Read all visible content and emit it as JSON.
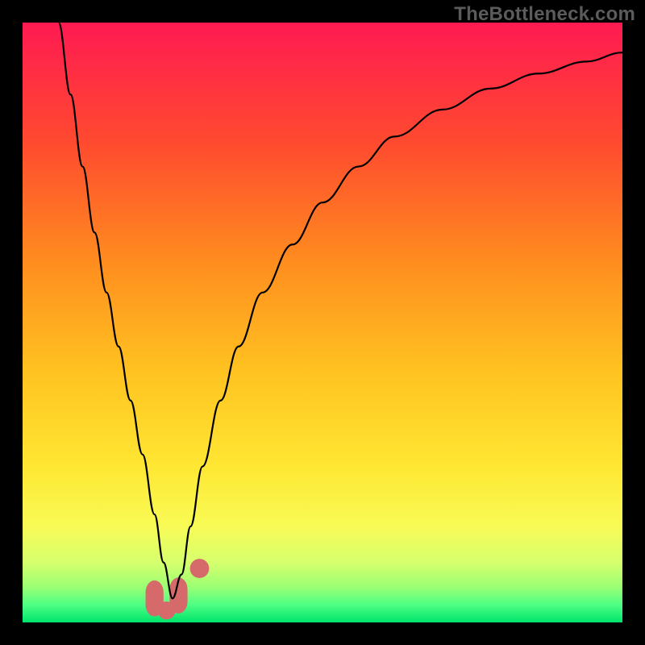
{
  "watermark": "TheBottleneck.com",
  "chart_data": {
    "type": "line",
    "title": "",
    "xlabel": "",
    "ylabel": "",
    "xlim": [
      0,
      100
    ],
    "ylim": [
      0,
      100
    ],
    "grid": false,
    "legend": false,
    "background_gradient": {
      "stops": [
        {
          "offset": 0.0,
          "color": "#ff1a52"
        },
        {
          "offset": 0.2,
          "color": "#ff4a2f"
        },
        {
          "offset": 0.4,
          "color": "#ff8d1f"
        },
        {
          "offset": 0.58,
          "color": "#ffc220"
        },
        {
          "offset": 0.74,
          "color": "#ffe733"
        },
        {
          "offset": 0.84,
          "color": "#f8fb56"
        },
        {
          "offset": 0.9,
          "color": "#d6ff6d"
        },
        {
          "offset": 0.94,
          "color": "#9dff73"
        },
        {
          "offset": 0.97,
          "color": "#4fff84"
        },
        {
          "offset": 1.0,
          "color": "#00e46b"
        }
      ]
    },
    "series": [
      {
        "name": "bottleneck-curve",
        "color": "#000000",
        "width": 2.2,
        "x": [
          6,
          8,
          10,
          12,
          14,
          16,
          18,
          20,
          22,
          23.5,
          25,
          26.5,
          28,
          30,
          33,
          36,
          40,
          45,
          50,
          56,
          62,
          70,
          78,
          86,
          94,
          100
        ],
        "values": [
          100,
          88,
          76,
          65,
          55,
          46,
          37,
          28,
          18,
          10,
          4,
          8,
          16,
          26,
          37,
          46,
          55,
          63,
          70,
          76,
          81,
          85.5,
          89,
          91.5,
          93.5,
          95
        ]
      }
    ],
    "markers": [
      {
        "name": "left-lobe",
        "shape": "round-rect",
        "color": "#d66a6a",
        "x": 22.0,
        "y": 4.0,
        "w": 3.0,
        "h": 6.0,
        "rx": 2.0
      },
      {
        "name": "trough",
        "shape": "round-rect",
        "color": "#d66a6a",
        "x": 24.0,
        "y": 2.0,
        "w": 3.0,
        "h": 3.0,
        "rx": 1.5
      },
      {
        "name": "right-lobe",
        "shape": "round-rect",
        "color": "#d66a6a",
        "x": 26.0,
        "y": 4.5,
        "w": 3.0,
        "h": 6.0,
        "rx": 2.0
      },
      {
        "name": "right-dot",
        "shape": "circle",
        "color": "#d66a6a",
        "x": 29.5,
        "y": 9.0,
        "r": 1.6
      }
    ]
  }
}
